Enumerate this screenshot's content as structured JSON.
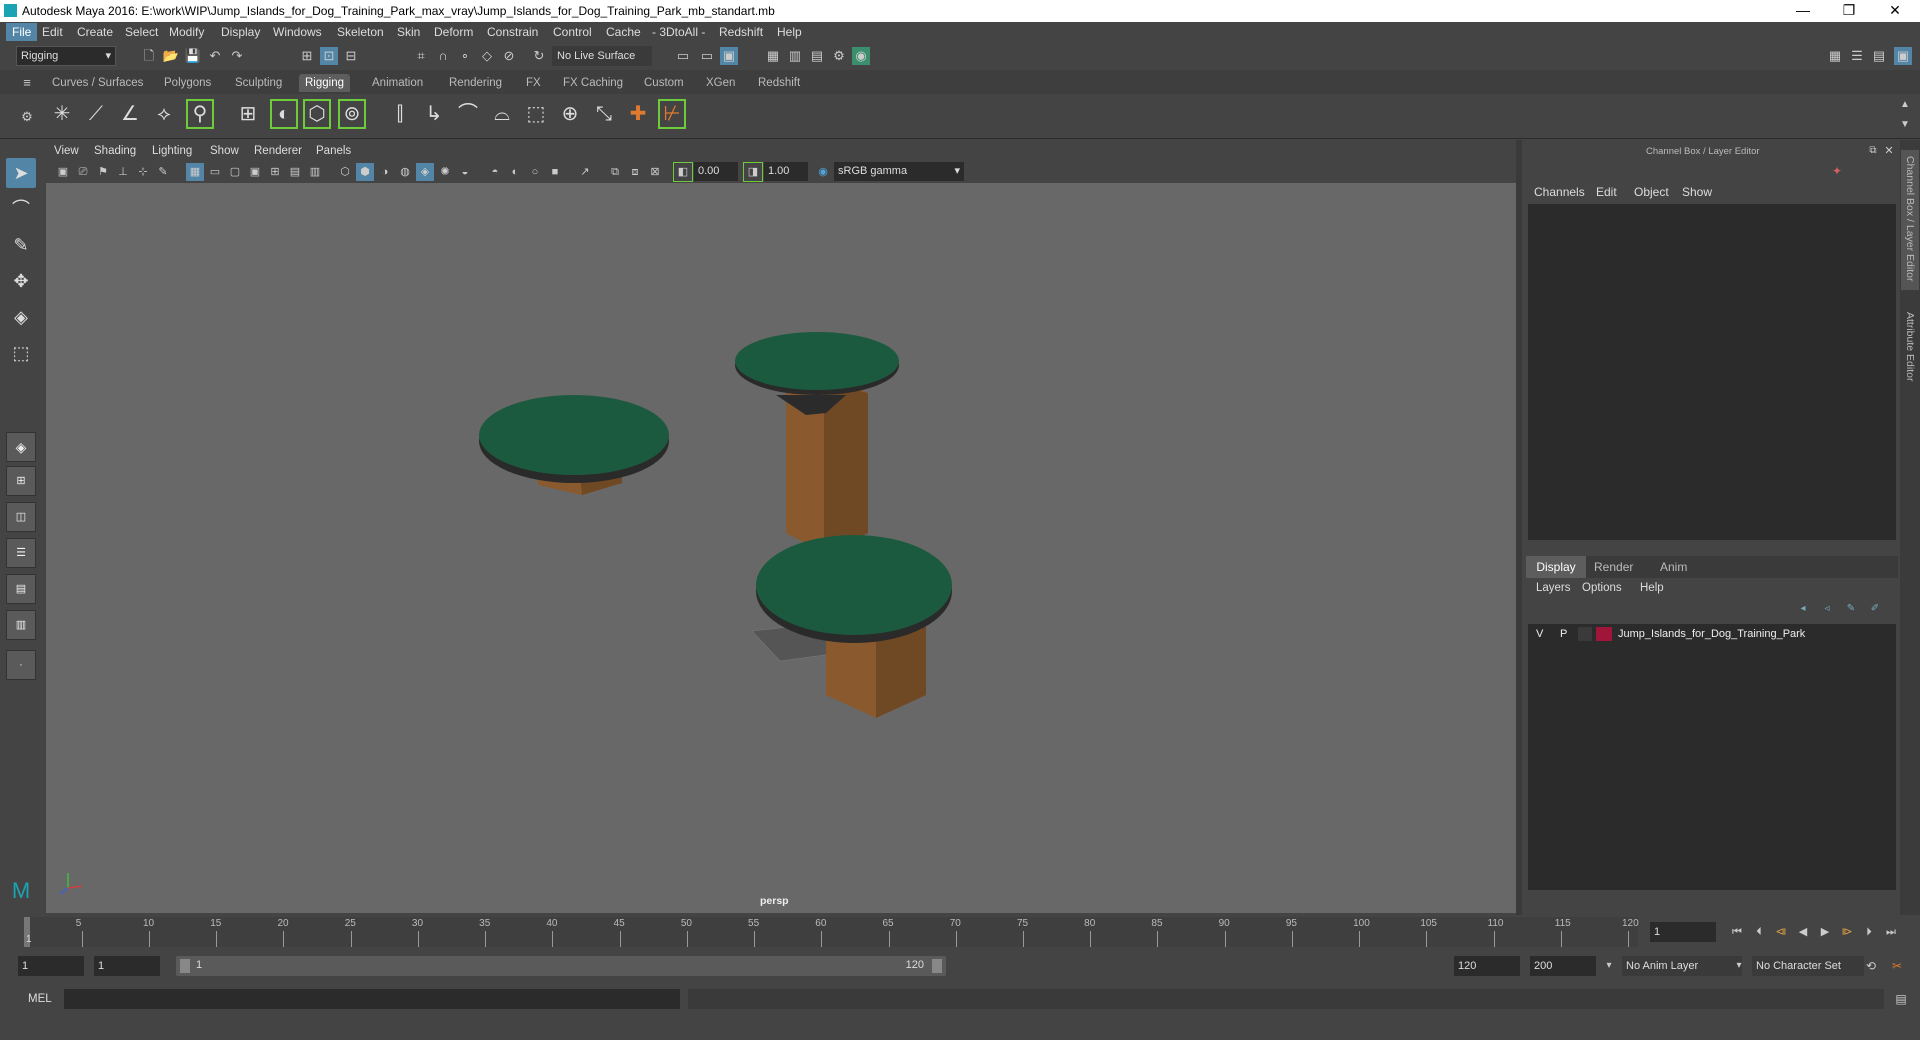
{
  "window": {
    "title": "Autodesk Maya 2016: E:\\work\\WIP\\Jump_Islands_for_Dog_Training_Park_max_vray\\Jump_Islands_for_Dog_Training_Park_mb_standart.mb",
    "minimize": "—",
    "maximize": "❐",
    "close": "✕"
  },
  "menubar": [
    "File",
    "Edit",
    "Create",
    "Select",
    "Modify",
    "Display",
    "Windows",
    "Skeleton",
    "Skin",
    "Deform",
    "Constrain",
    "Control",
    "Cache",
    "- 3DtoAll -",
    "Redshift",
    "Help"
  ],
  "status_line": {
    "mode_menu": "Rigging",
    "live_surface": "No Live Surface"
  },
  "shelf_tabs": [
    "Curves / Surfaces",
    "Polygons",
    "Sculpting",
    "Rigging",
    "Animation",
    "Rendering",
    "FX",
    "FX Caching",
    "Custom",
    "XGen",
    "Redshift"
  ],
  "active_shelf_tab": "Rigging",
  "panel_menu": [
    "View",
    "Shading",
    "Lighting",
    "Show",
    "Renderer",
    "Panels"
  ],
  "viewport_toolbar": {
    "exposure": "0.00",
    "gamma": "1.00",
    "color_space": "sRGB gamma"
  },
  "viewport": {
    "camera_label": "persp"
  },
  "channel_box": {
    "title": "Channel Box / Layer Editor",
    "menus": [
      "Channels",
      "Edit",
      "Object",
      "Show"
    ]
  },
  "layer_editor": {
    "tabs": [
      "Display",
      "Render",
      "Anim"
    ],
    "active_tab": "Display",
    "menus": [
      "Layers",
      "Options",
      "Help"
    ],
    "layers": [
      {
        "visible": "V",
        "playback": "P",
        "name": "Jump_Islands_for_Dog_Training_Park",
        "color": "#a0163a"
      }
    ]
  },
  "side_tabs": [
    "Channel Box / Layer Editor",
    "Attribute Editor"
  ],
  "time_slider": {
    "ticks": [
      "5",
      "10",
      "15",
      "20",
      "25",
      "30",
      "35",
      "40",
      "45",
      "50",
      "55",
      "60",
      "65",
      "70",
      "75",
      "80",
      "85",
      "90",
      "95",
      "100",
      "105",
      "110",
      "115",
      "120"
    ],
    "first_tick": "1",
    "current_frame": "1"
  },
  "range_slider": {
    "start_frame": "1",
    "playback_start": "1",
    "range_start_label": "1",
    "range_end_label": "120",
    "playback_end": "120",
    "end_frame": "200",
    "anim_layer": "No Anim Layer",
    "character_set": "No Character Set"
  },
  "command_line": {
    "label": "MEL"
  },
  "colors": {
    "accent": "#5285a6",
    "viewport_bg": "#686868",
    "island_top": "#1b5a3e",
    "island_wood": "#8a5a2e"
  }
}
